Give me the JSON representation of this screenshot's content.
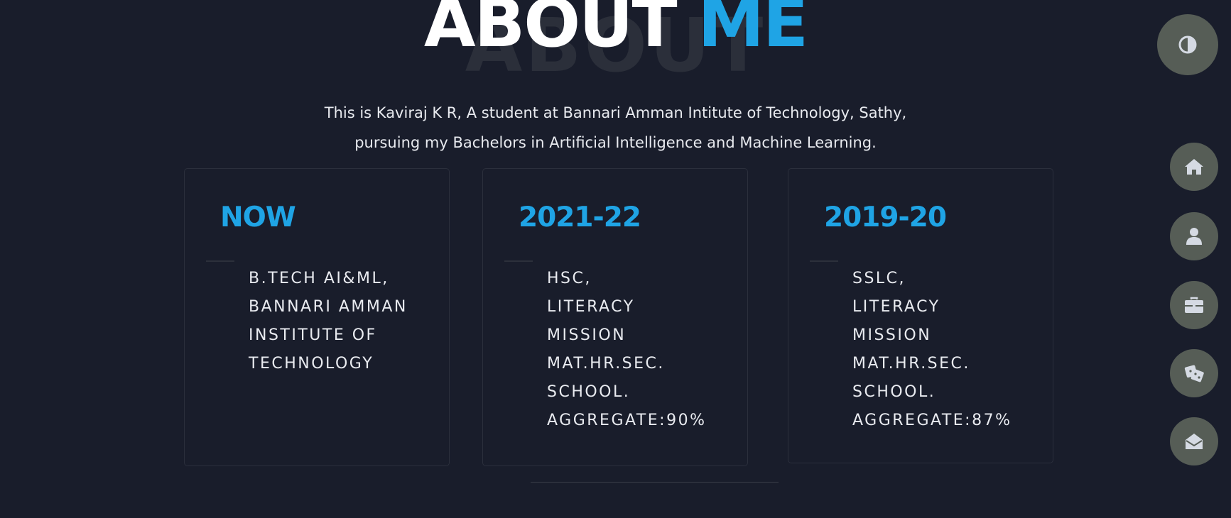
{
  "heading": {
    "word1": "ABOUT",
    "word2": "ME",
    "background_word": "ABOUT",
    "accent_color": "#1fa4e5"
  },
  "intro": {
    "line1": "This is Kaviraj K R, A student at Bannari Amman Intitute of Technology, Sathy,",
    "line2": "pursuing my Bachelors in Artificial Intelligence and Machine Learning."
  },
  "education": [
    {
      "year": "NOW",
      "lines": [
        "B.TECH AI&ML,",
        "BANNARI AMMAN",
        "INSTITUTE OF",
        "TECHNOLOGY"
      ]
    },
    {
      "year": "2021-22",
      "lines": [
        "HSC,",
        "LITERACY",
        "MISSION",
        "MAT.HR.SEC.",
        "SCHOOL.",
        "AGGREGATE:90%"
      ]
    },
    {
      "year": "2019-20",
      "lines": [
        "SSLC,",
        "LITERACY",
        "MISSION",
        "MAT.HR.SEC.",
        "SCHOOL.",
        "AGGREGATE:87%"
      ]
    }
  ],
  "controls": {
    "theme_toggle_icon": "contrast-icon",
    "nav": [
      {
        "icon": "home-icon"
      },
      {
        "icon": "user-icon"
      },
      {
        "icon": "briefcase-icon"
      },
      {
        "icon": "dice-icon"
      },
      {
        "icon": "envelope-open-icon"
      }
    ],
    "button_color": "#565d56",
    "icon_color": "#d5dae3"
  }
}
